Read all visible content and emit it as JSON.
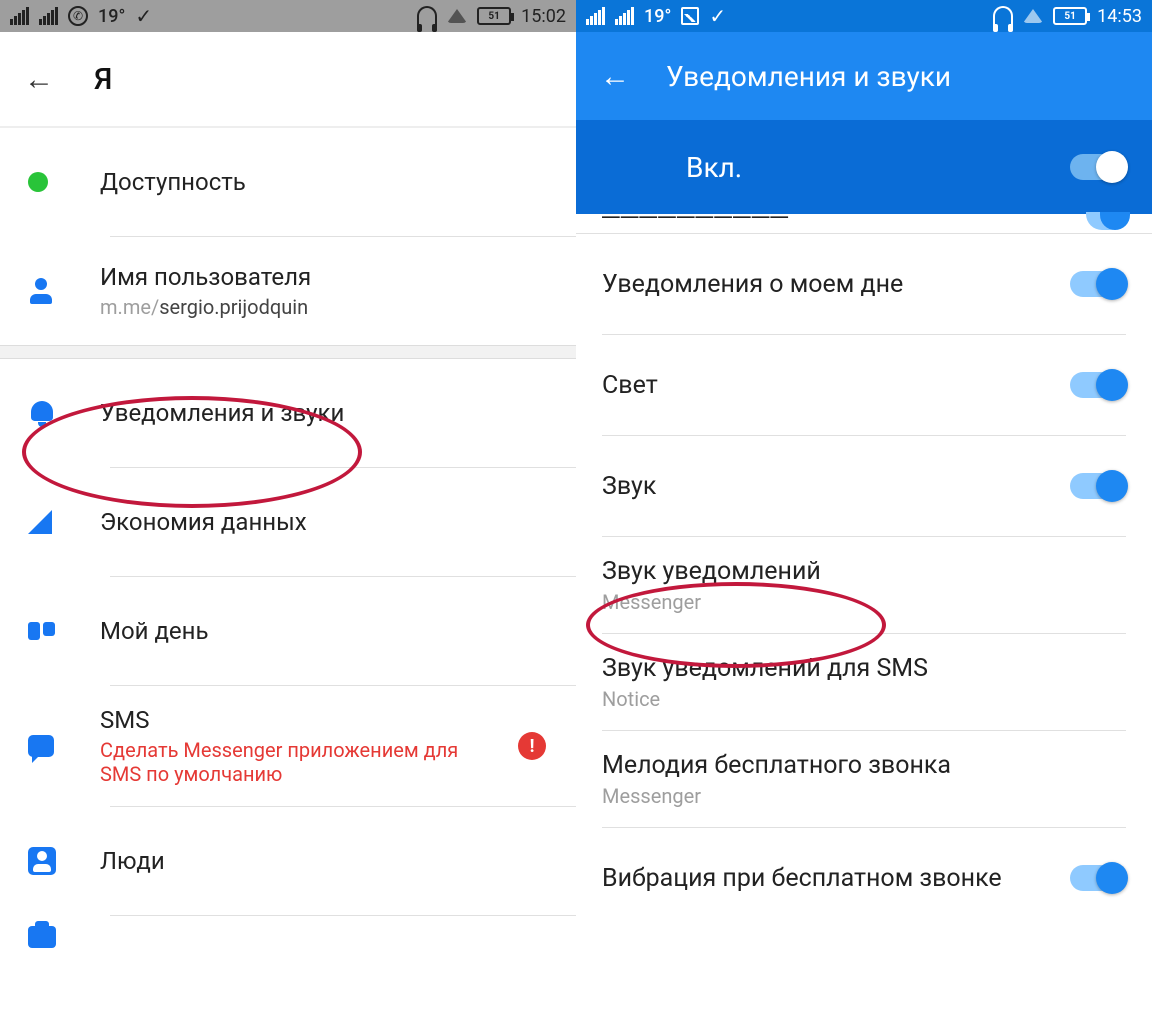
{
  "left": {
    "status": {
      "temp": "19°",
      "battery": "51",
      "time": "15:02"
    },
    "header": {
      "title": "Я"
    },
    "items": {
      "availability": "Доступность",
      "username": {
        "title": "Имя пользователя",
        "prefix": "m.me/",
        "value": "sergio.prijodquin"
      },
      "notifications": "Уведомления и звуки",
      "data_saver": "Экономия данных",
      "my_day": "Мой день",
      "sms": {
        "title": "SMS",
        "sub": "Сделать Messenger приложением для SMS по умолчанию"
      },
      "people": "Люди"
    }
  },
  "right": {
    "status": {
      "temp": "19°",
      "battery": "51",
      "time": "14:53"
    },
    "header": {
      "title": "Уведомления и звуки",
      "master": "Вкл."
    },
    "items": {
      "vibration_cut": "Вибрация",
      "my_day_notif": "Уведомления о моем дне",
      "light": "Свет",
      "sound": "Звук",
      "notif_sound": {
        "title": "Звук уведомлений",
        "sub": "Messenger"
      },
      "sms_sound": {
        "title": "Звук уведомлений для SMS",
        "sub": "Notice"
      },
      "call_melody": {
        "title": "Мелодия бесплатного звонка",
        "sub": "Messenger"
      },
      "call_vibration": "Вибрация при бесплатном звонке"
    }
  }
}
